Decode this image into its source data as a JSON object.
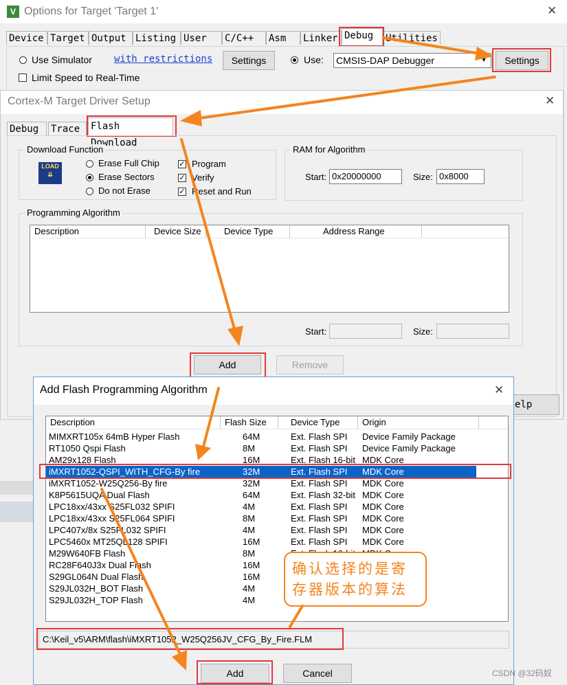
{
  "options_window": {
    "title": "Options for Target 'Target 1'",
    "tabs": [
      "Device",
      "Target",
      "Output",
      "Listing",
      "User",
      "C/C++",
      "Asm",
      "Linker",
      "Debug",
      "Utilities"
    ],
    "use_simulator": "Use Simulator",
    "with_restrictions": "with restrictions",
    "settings_left": "Settings",
    "limit_speed": "Limit Speed to Real-Time",
    "use_label": "Use:",
    "debugger": "CMSIS-DAP Debugger",
    "settings_right": "Settings",
    "help_partial": "elp"
  },
  "driver_window": {
    "title": "Cortex-M Target Driver Setup",
    "tabs": [
      "Debug",
      "Trace",
      "Flash Download"
    ],
    "download_function": {
      "label": "Download Function",
      "load_icon_text": "LOAD",
      "radios": [
        "Erase Full Chip",
        "Erase Sectors",
        "Do not Erase"
      ],
      "checks": [
        "Program",
        "Verify",
        "Reset and Run"
      ]
    },
    "ram": {
      "label": "RAM for Algorithm",
      "start_label": "Start:",
      "start": "0x20000000",
      "size_label": "Size:",
      "size": "0x8000"
    },
    "programming": {
      "label": "Programming Algorithm",
      "columns": [
        "Description",
        "Device Size",
        "Device Type",
        "Address Range"
      ],
      "start_label": "Start:",
      "size_label": "Size:"
    },
    "add": "Add",
    "remove": "Remove"
  },
  "add_window": {
    "title": "Add Flash Programming Algorithm",
    "columns": [
      "Description",
      "Flash Size",
      "Device Type",
      "Origin"
    ],
    "rows": [
      [
        "MIMXRT105x 64mB Hyper Flash",
        "64M",
        "Ext. Flash SPI",
        "Device Family Package"
      ],
      [
        "RT1050 Qspi Flash",
        "8M",
        "Ext. Flash SPI",
        "Device Family Package"
      ],
      [
        "AM29x128 Flash",
        "16M",
        "Ext. Flash 16-bit",
        "MDK Core"
      ],
      [
        "iMXRT1052-QSPI_WITH_CFG-By fire",
        "32M",
        "Ext. Flash SPI",
        "MDK Core"
      ],
      [
        "iMXRT1052-W25Q256-By fire",
        "32M",
        "Ext. Flash SPI",
        "MDK Core"
      ],
      [
        "K8P5615UQA Dual Flash",
        "64M",
        "Ext. Flash 32-bit",
        "MDK Core"
      ],
      [
        "LPC18xx/43xx S25FL032 SPIFI",
        "4M",
        "Ext. Flash SPI",
        "MDK Core"
      ],
      [
        "LPC18xx/43xx S25FL064 SPIFI",
        "8M",
        "Ext. Flash SPI",
        "MDK Core"
      ],
      [
        "LPC407x/8x S25FL032 SPIFI",
        "4M",
        "Ext. Flash SPI",
        "MDK Core"
      ],
      [
        "LPC5460x MT25QL128 SPIFI",
        "16M",
        "Ext. Flash SPI",
        "MDK Core"
      ],
      [
        "M29W640FB Flash",
        "8M",
        "Ext. Flash 16-bit",
        "MDK Core"
      ],
      [
        "RC28F640J3x Dual Flash",
        "16M",
        "",
        ""
      ],
      [
        "S29GL064N Dual Flash",
        "16M",
        "",
        ""
      ],
      [
        "S29JL032H_BOT Flash",
        "4M",
        "",
        ""
      ],
      [
        "S29JL032H_TOP Flash",
        "4M",
        "",
        ""
      ]
    ],
    "selected_index": 3,
    "path": "C:\\Keil_v5\\ARM\\flash\\iMXRT1052_W25Q256JV_CFG_By_Fire.FLM",
    "add": "Add",
    "cancel": "Cancel"
  },
  "callout": {
    "text": "确认选择的是寄存器版本的算法"
  },
  "watermark": "CSDN @32码奴",
  "colors": {
    "annotation_red": "#e1393b",
    "arrow_orange": "#f5841f",
    "selection_blue": "#0a64c8"
  }
}
